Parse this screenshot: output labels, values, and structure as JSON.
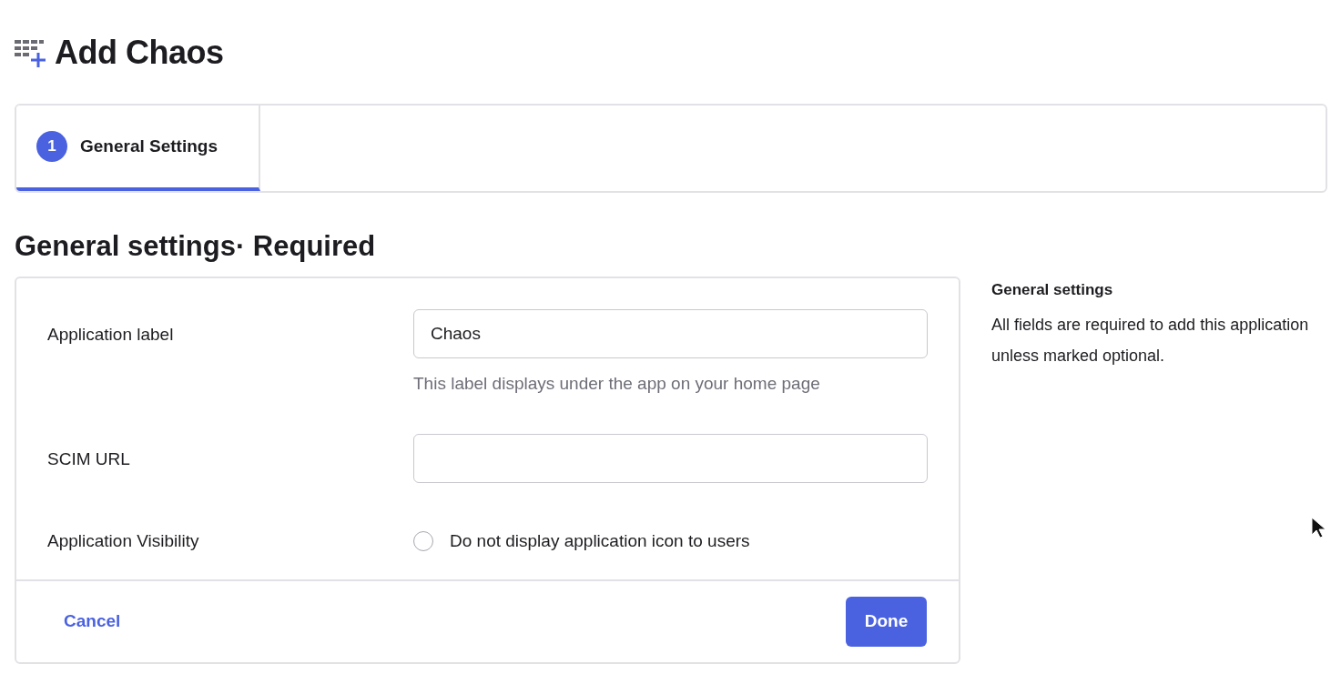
{
  "page_title": "Add Chaos",
  "steps": [
    {
      "number": "1",
      "label": "General Settings",
      "selected": true
    }
  ],
  "section_title": "General settings· Required",
  "fields": [
    {
      "kind": "text",
      "label": "Application label",
      "value": "Chaos",
      "help": "This label displays under the app on your home page"
    },
    {
      "kind": "text",
      "label": "SCIM URL"
    },
    {
      "kind": "checkbox",
      "label": "Application Visibility",
      "option": "Do not display application icon to users",
      "checked": false
    }
  ],
  "actions": {
    "cancel": "Cancel",
    "done": "Done"
  },
  "aside": {
    "title": "General settings",
    "text": "All fields are required to add this application unless marked optional."
  }
}
